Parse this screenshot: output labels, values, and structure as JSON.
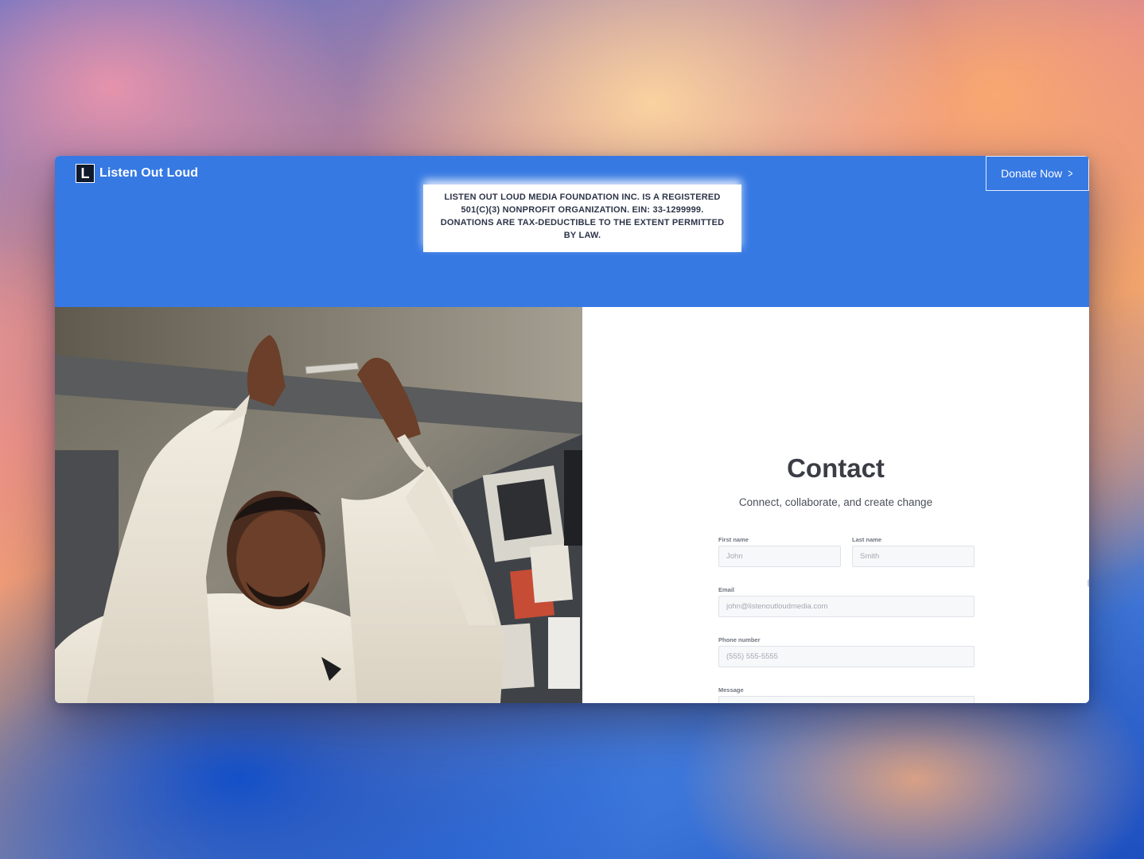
{
  "header": {
    "brand_mark": "L",
    "brand_name": "Listen Out Loud",
    "donate_label": "Donate Now",
    "donate_icon": "chevron-right-icon"
  },
  "notice": {
    "text": "LISTEN OUT LOUD MEDIA FOUNDATION INC. IS A REGISTERED 501(C)(3) NONPROFIT ORGANIZATION. EIN: 33-1299999. DONATIONS ARE TAX-DEDUCTIBLE TO THE EXTENT PERMITTED BY LAW."
  },
  "contact": {
    "title": "Contact",
    "subtitle": "Connect, collaborate, and create change",
    "fields": {
      "first_name": {
        "label": "First name",
        "placeholder": "John"
      },
      "last_name": {
        "label": "Last name",
        "placeholder": "Smith"
      },
      "email": {
        "label": "Email",
        "placeholder": "john@listenoutloudmedia.com"
      },
      "phone": {
        "label": "Phone number",
        "placeholder": "(555) 555-5555"
      },
      "message": {
        "label": "Message",
        "placeholder": ""
      }
    }
  },
  "colors": {
    "hero_blue": "#3679e3",
    "brand_mark_bg": "#111a2c",
    "title_text": "#3a3d44"
  }
}
